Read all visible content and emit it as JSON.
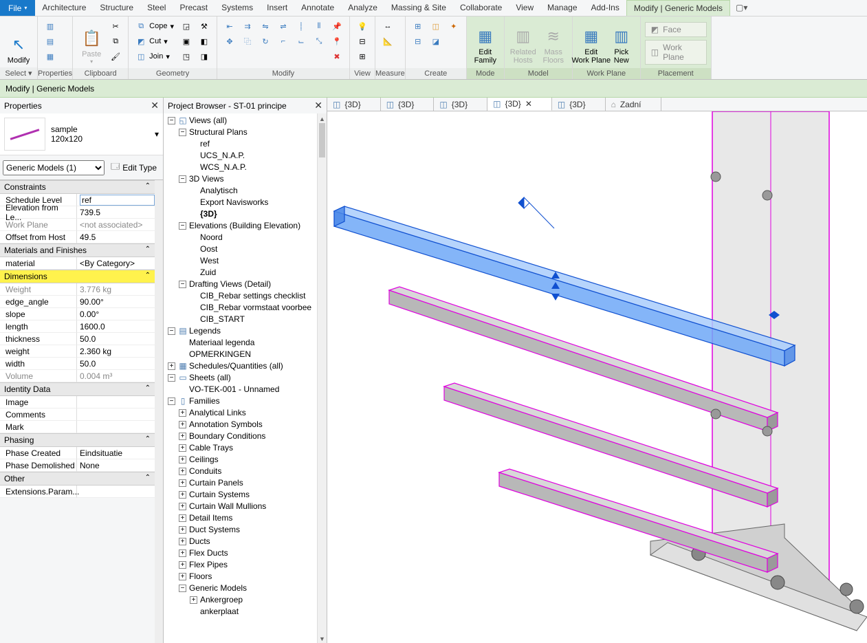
{
  "menubar": {
    "file": "File",
    "items": [
      "Architecture",
      "Structure",
      "Steel",
      "Precast",
      "Systems",
      "Insert",
      "Annotate",
      "Analyze",
      "Massing & Site",
      "Collaborate",
      "View",
      "Manage",
      "Add-Ins"
    ],
    "active": "Modify | Generic Models"
  },
  "ribbon": {
    "select": {
      "modify": "Modify",
      "select": "Select ▾",
      "group": "Select"
    },
    "properties": {
      "btn": "Properties",
      "group": "Properties"
    },
    "clipboard": {
      "paste": "Paste",
      "cope": "Cope",
      "cut": "Cut",
      "join": "Join",
      "group": "Clipboard"
    },
    "geometry": {
      "group": "Geometry"
    },
    "modify": {
      "group": "Modify"
    },
    "view": {
      "group": "View"
    },
    "measure": {
      "group": "Measure"
    },
    "create": {
      "group": "Create"
    },
    "mode": {
      "edit_family": "Edit\nFamily",
      "group": "Mode"
    },
    "model": {
      "related": "Related\nHosts",
      "mass": "Mass\nFloors",
      "group": "Model"
    },
    "workplane": {
      "edit": "Edit\nWork Plane",
      "group": "Work Plane"
    },
    "picknew": {
      "btn": "Pick\nNew"
    },
    "placement": {
      "face": "Face",
      "wp": "Work Plane",
      "group": "Placement"
    }
  },
  "context_bar": "Modify | Generic Models",
  "properties_panel": {
    "title": "Properties",
    "type_name": "sample",
    "type_size": "120x120",
    "filter": "Generic Models (1)",
    "edit_type": "Edit Type",
    "sections": {
      "constraints": "Constraints",
      "materials": "Materials and Finishes",
      "dimensions": "Dimensions",
      "identity": "Identity Data",
      "phasing": "Phasing",
      "other": "Other"
    },
    "rows": {
      "schedule_level_k": "Schedule Level",
      "schedule_level_v": "ref",
      "elev_k": "Elevation from Le...",
      "elev_v": "739.5",
      "workplane_k": "Work Plane",
      "workplane_v": "<not associated>",
      "offset_k": "Offset from Host",
      "offset_v": "49.5",
      "material_k": "material",
      "material_v": "<By Category>",
      "weightcap_k": "Weight",
      "weightcap_v": "3.776 kg",
      "edge_k": "edge_angle",
      "edge_v": "90.00°",
      "slope_k": "slope",
      "slope_v": "0.00°",
      "length_k": "length",
      "length_v": "1600.0",
      "thick_k": "thickness",
      "thick_v": "50.0",
      "weight_k": "weight",
      "weight_v": "2.360 kg",
      "width_k": "width",
      "width_v": "50.0",
      "volume_k": "Volume",
      "volume_v": "0.004 m³",
      "image_k": "Image",
      "image_v": "",
      "comments_k": "Comments",
      "comments_v": "",
      "mark_k": "Mark",
      "mark_v": "",
      "phasecr_k": "Phase Created",
      "phasecr_v": "Eindsituatie",
      "phasedm_k": "Phase Demolished",
      "phasedm_v": "None",
      "ext_k": "Extensions.Param...",
      "ext_v": ""
    }
  },
  "browser": {
    "title": "Project Browser - ST-01 principe",
    "views_root": "Views (all)",
    "structural_plans": "Structural Plans",
    "sp": {
      "ref": "ref",
      "ucs": "UCS_N.A.P.",
      "wcs": "WCS_N.A.P."
    },
    "tdviews": "3D Views",
    "tv": {
      "ana": "Analytisch",
      "exp": "Export Navisworks",
      "d3": "{3D}"
    },
    "elevs": "Elevations (Building Elevation)",
    "el": {
      "n": "Noord",
      "o": "Oost",
      "w": "West",
      "z": "Zuid"
    },
    "drafting": "Drafting Views (Detail)",
    "dr": {
      "a": "CIB_Rebar settings checklist",
      "b": "CIB_Rebar vormstaat voorbee",
      "c": "CIB_START"
    },
    "legends": "Legends",
    "lg": {
      "a": "Materiaal legenda",
      "b": "OPMERKINGEN"
    },
    "schedules": "Schedules/Quantities (all)",
    "sheets": "Sheets (all)",
    "sh": {
      "a": "VO-TEK-001 - Unnamed"
    },
    "families": "Families",
    "fam": [
      "Analytical Links",
      "Annotation Symbols",
      "Boundary Conditions",
      "Cable Trays",
      "Ceilings",
      "Conduits",
      "Curtain Panels",
      "Curtain Systems",
      "Curtain Wall Mullions",
      "Detail Items",
      "Duct Systems",
      "Ducts",
      "Flex Ducts",
      "Flex Pipes",
      "Floors",
      "Generic Models"
    ],
    "gm": {
      "a": "Ankergroep",
      "b": "ankerplaat"
    }
  },
  "viewtabs": [
    {
      "label": "{3D}",
      "icon": "cube"
    },
    {
      "label": "{3D}",
      "icon": "cube"
    },
    {
      "label": "{3D}",
      "icon": "cube"
    },
    {
      "label": "{3D}",
      "icon": "cube",
      "active": true,
      "close": true
    },
    {
      "label": "{3D}",
      "icon": "cube"
    },
    {
      "label": "Zadní",
      "icon": "house"
    }
  ]
}
